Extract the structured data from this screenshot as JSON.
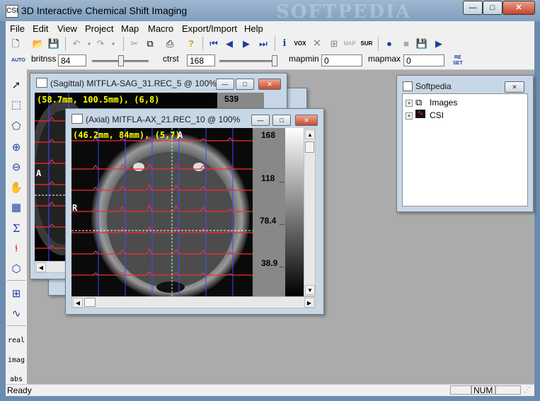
{
  "window": {
    "title": "3D Interactive Chemical Shift Imaging",
    "watermark": "SOFTPEDIA",
    "app_icon": "CSI"
  },
  "caption_buttons": {
    "minimize": "—",
    "maximize": "□",
    "close": "✕"
  },
  "menu": [
    "File",
    "Edit",
    "View",
    "Project",
    "Map",
    "Macro",
    "Export/Import",
    "Help"
  ],
  "toolbar1": {
    "icons": [
      "new-file-icon",
      "open-folder-icon",
      "save-icon",
      "undo-icon",
      "redo-icon",
      "cut-icon",
      "copy-icon",
      "print-icon",
      "help-icon",
      "first-icon",
      "prev-icon",
      "next-icon",
      "last-icon",
      "info-icon",
      "vox",
      "delete-icon",
      "grid-icon",
      "map",
      "sur",
      "record-icon",
      "stop-icon",
      "save-icon",
      "play-icon"
    ],
    "vox_label": "VOX",
    "map_label": "MAP",
    "sur_label": "SUR"
  },
  "toolbar2": {
    "auto_label": "AUTO",
    "brightness_label": "britnss",
    "brightness_value": "84",
    "contrast_label": "ctrst",
    "contrast_value": "168",
    "mapmin_label": "mapmin",
    "mapmin_value": "0",
    "mapmax_label": "mapmax",
    "mapmax_value": "0",
    "reset_label_top": "RE",
    "reset_label_bottom": "SET"
  },
  "left_tools": {
    "icons": [
      "pointer-icon",
      "rect-select-icon",
      "polygon-icon",
      "zoom-in-icon",
      "zoom-out-icon",
      "pan-icon",
      "voxel-grid-icon",
      "sum-icon",
      "baseline-icon",
      "region-icon",
      "grid-overlay-icon",
      "spectrum-icon"
    ],
    "real_label": "real",
    "imag_label": "imag",
    "abs_label": "abs"
  },
  "sagittal": {
    "title": "(Sagittal) MITFLA-SAG_31.REC_5 @ 100%",
    "coord": "(58.7mm, 100.5mm), (6,8)",
    "orient": "A",
    "scale_top": "539"
  },
  "axial": {
    "title": "(Axial) MITFLA-AX_21.REC_10 @ 100%",
    "coord": "(46.2mm, 84mm), (5,7)",
    "orient_top": "A",
    "orient_left": "R",
    "scale_labels": [
      "168",
      "118",
      "78.4",
      "38.9"
    ],
    "underscore": "_"
  },
  "tree": {
    "title": "Softpedia",
    "items": [
      {
        "label": "Images",
        "expander": "+"
      },
      {
        "label": "CSI",
        "expander": "+"
      }
    ]
  },
  "status": {
    "text": "Ready",
    "num": "NUM"
  },
  "colors": {
    "titlebar": "#8fadc9",
    "spectrum": "#ff2a2a",
    "grid": "#3a4cff",
    "coord": "#ffff00"
  }
}
